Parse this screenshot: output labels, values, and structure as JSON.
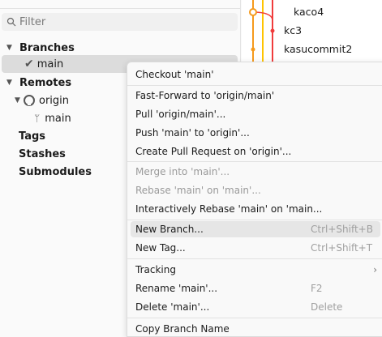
{
  "sidebar": {
    "filter_placeholder": "Filter",
    "branches_label": "Branches",
    "local_branch": "main",
    "remotes_label": "Remotes",
    "remote_name": "origin",
    "remote_branch": "main",
    "tags_label": "Tags",
    "stashes_label": "Stashes",
    "submodules_label": "Submodules"
  },
  "graph": {
    "commits": [
      "kaco4",
      "kc3",
      "kasucommit2"
    ],
    "colors": {
      "orange": "#f59a1c",
      "yellow": "#ffc400",
      "red": "#f03c3c"
    }
  },
  "menu": {
    "checkout": "Checkout 'main'",
    "fast_forward": "Fast-Forward to 'origin/main'",
    "pull": "Pull 'origin/main'...",
    "push": "Push 'main' to 'origin'...",
    "create_pr": "Create Pull Request on 'origin'...",
    "merge": "Merge into 'main'...",
    "rebase": "Rebase 'main' on 'main'...",
    "interactive_rebase": "Interactively Rebase 'main' on 'main...",
    "new_branch": "New Branch...",
    "new_branch_shortcut": "Ctrl+Shift+B",
    "new_tag": "New Tag...",
    "new_tag_shortcut": "Ctrl+Shift+T",
    "tracking": "Tracking",
    "rename": "Rename 'main'...",
    "rename_shortcut": "F2",
    "delete": "Delete 'main'...",
    "delete_shortcut": "Delete",
    "copy_name": "Copy Branch Name"
  }
}
